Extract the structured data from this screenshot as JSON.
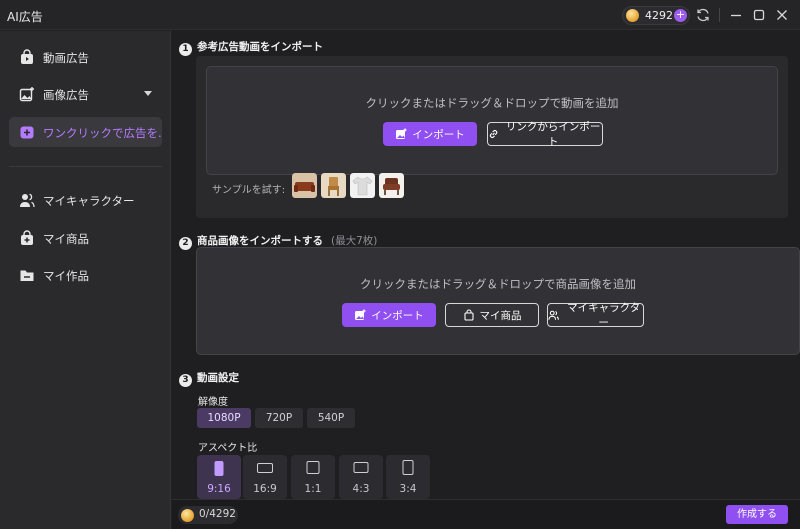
{
  "app": {
    "title": "AI広告"
  },
  "header": {
    "coins": "4292",
    "plus": "+"
  },
  "sidebar": {
    "items": [
      {
        "label": "動画広告"
      },
      {
        "label": "画像広告"
      },
      {
        "label": "ワンクリックで広告を..."
      },
      {
        "label": "マイキャラクター"
      },
      {
        "label": "マイ商品"
      },
      {
        "label": "マイ作品"
      }
    ]
  },
  "section1": {
    "num": "1",
    "title": "参考広告動画をインポート",
    "drop_text": "クリックまたはドラッグ＆ドロップで動画を追加",
    "import_label": "インポート",
    "link_import_label": "リンクからインポート",
    "sample_label": "サンプルを試す:"
  },
  "section2": {
    "num": "2",
    "title": "商品画像をインポートする",
    "hint": "(最大7枚)",
    "drop_text": "クリックまたはドラッグ＆ドロップで商品画像を追加",
    "import_label": "インポート",
    "my_products_label": "マイ商品",
    "my_characters_label": "マイキャラクター"
  },
  "section3": {
    "num": "3",
    "title": "動画設定",
    "resolution_label": "解像度",
    "resolutions": [
      "1080P",
      "720P",
      "540P"
    ],
    "aspect_label": "アスペクト比",
    "aspects": [
      "9:16",
      "16:9",
      "1:1",
      "4:3",
      "3:4"
    ]
  },
  "footer": {
    "cost": "0/4292",
    "create_label": "作成する"
  },
  "colors": {
    "accent": "#8f4ff1",
    "active_text": "#b57bff",
    "background": "#1f1f22"
  }
}
